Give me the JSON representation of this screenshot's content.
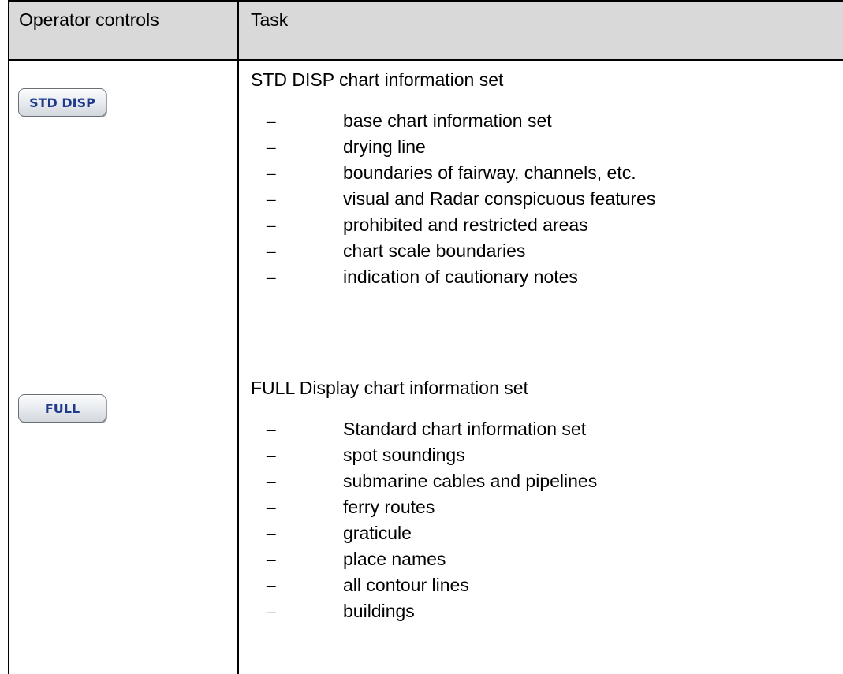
{
  "header": {
    "operator_controls": "Operator controls",
    "task": "Task"
  },
  "sections": [
    {
      "button_label": "STD DISP",
      "title": "STD DISP chart information set",
      "items": [
        "base chart information set",
        "drying line",
        "boundaries of fairway, channels, etc.",
        "visual and Radar conspicuous features",
        "prohibited and restricted areas",
        "chart scale boundaries",
        "indication of cautionary notes"
      ]
    },
    {
      "button_label": "FULL",
      "title": "FULL Display chart information set",
      "items": [
        "Standard chart information set",
        "spot soundings",
        "submarine cables and pipelines",
        "ferry routes",
        "graticule",
        "place names",
        "all contour lines",
        "buildings"
      ]
    }
  ],
  "bullet_glyph": "–",
  "colors": {
    "header_background": "#d9d9d9",
    "button_text": "#1f3a8a"
  }
}
